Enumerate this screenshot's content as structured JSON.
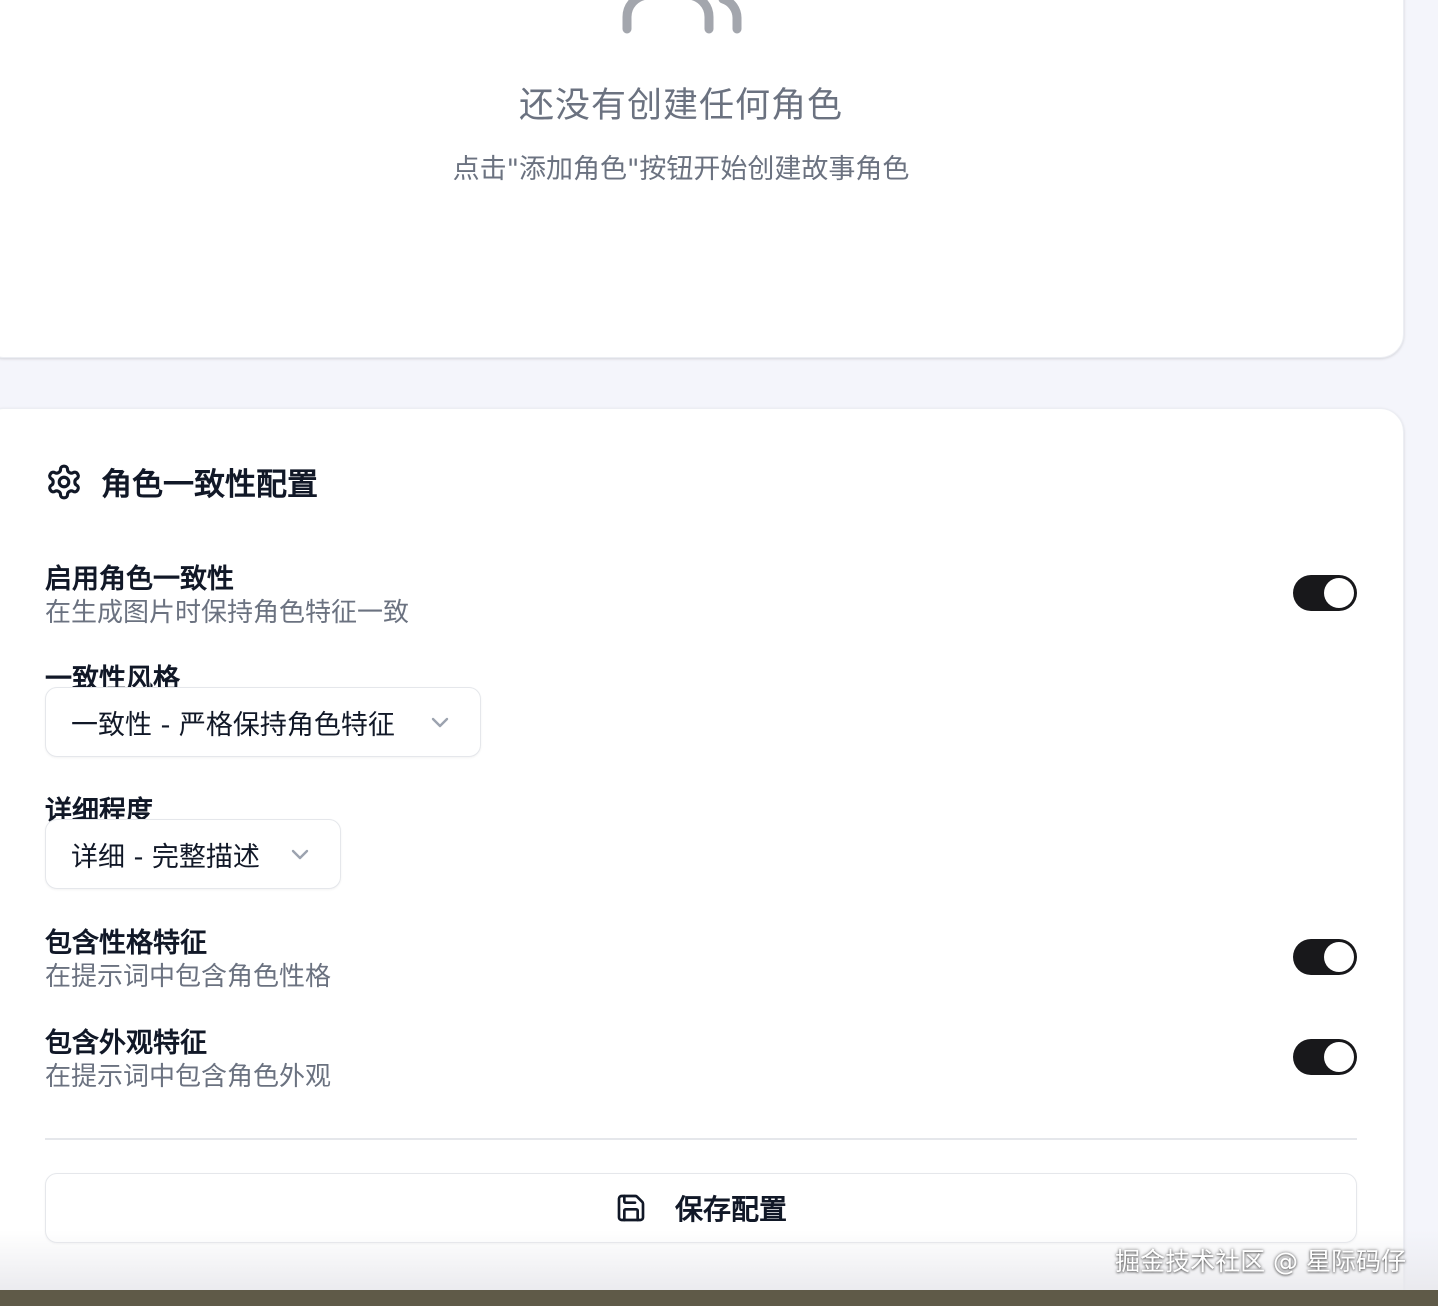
{
  "empty_state": {
    "title": "还没有创建任何角色",
    "description": "点击\"添加角色\"按钮开始创建故事角色",
    "icon": "users-icon"
  },
  "config": {
    "title": "角色一致性配置",
    "icon": "gear-icon",
    "enable_consistency": {
      "label": "启用角色一致性",
      "description": "在生成图片时保持角色特征一致",
      "enabled": true
    },
    "consistency_style": {
      "label": "一致性风格",
      "selected": "一致性 - 严格保持角色特征"
    },
    "detail_level": {
      "label": "详细程度",
      "selected": "详细 - 完整描述"
    },
    "include_personality": {
      "label": "包含性格特征",
      "description": "在提示词中包含角色性格",
      "enabled": true
    },
    "include_appearance": {
      "label": "包含外观特征",
      "description": "在提示词中包含角色外观",
      "enabled": true
    },
    "save_button": {
      "label": "保存配置",
      "icon": "save-icon"
    }
  },
  "watermark": "掘金技术社区 @ 星际码仔",
  "colors": {
    "switch_on": "#18181b",
    "muted_text": "#6b7280",
    "page_background": "#f4f5fb"
  }
}
